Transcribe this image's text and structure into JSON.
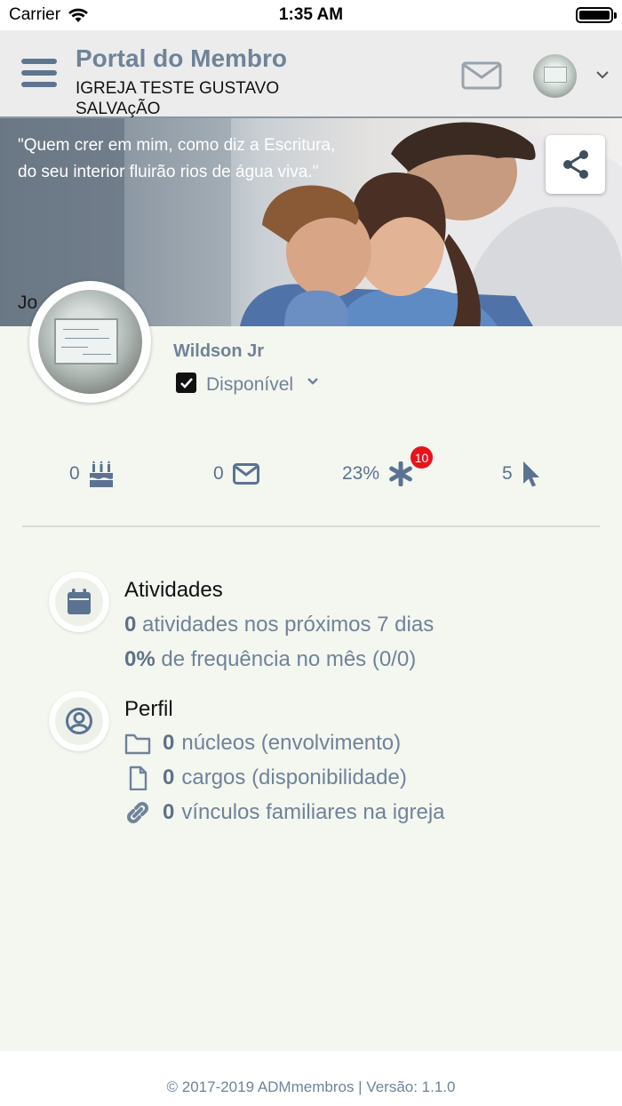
{
  "status_bar": {
    "carrier": "Carrier",
    "time": "1:35 AM"
  },
  "header": {
    "title": "Portal do Membro",
    "church": "IGREJA TESTE GUSTAVO SALVAçÃO",
    "icons": [
      "menu-icon",
      "mail-icon",
      "chevron-down-icon"
    ]
  },
  "banner": {
    "quote": "\"Quem crer em mim, como diz a Escritura, do seu interior fluirão rios de água viva.\"",
    "author": "Jo",
    "share_icon": "share-icon"
  },
  "profile": {
    "name": "Wildson Jr",
    "status": "Disponível",
    "status_checked": true
  },
  "stats": [
    {
      "value": "0",
      "icon": "birthday-cake-icon"
    },
    {
      "value": "0",
      "icon": "envelope-icon"
    },
    {
      "value": "23%",
      "icon": "asterisk-icon",
      "badge": "10"
    },
    {
      "value": "5",
      "icon": "pointer-icon"
    }
  ],
  "activities": {
    "title": "Atividades",
    "line1_count": "0",
    "line1_text": "atividades nos próximos 7 dias",
    "line2_count": "0%",
    "line2_text": "de frequência no mês (0/0)"
  },
  "profile_section": {
    "title": "Perfil",
    "rows": [
      {
        "icon": "folder-icon",
        "count": "0",
        "text": "núcleos (envolvimento)"
      },
      {
        "icon": "file-icon",
        "count": "0",
        "text": "cargos (disponibilidade)"
      },
      {
        "icon": "link-icon",
        "count": "0",
        "text": "vínculos familiares na igreja"
      }
    ]
  },
  "footer": {
    "text": "© 2017-2019 ADMmembros | Versão: 1.1.0"
  },
  "colors": {
    "accent": "#6f8399",
    "background": "#f4f6f0",
    "badge": "#e8121a"
  }
}
